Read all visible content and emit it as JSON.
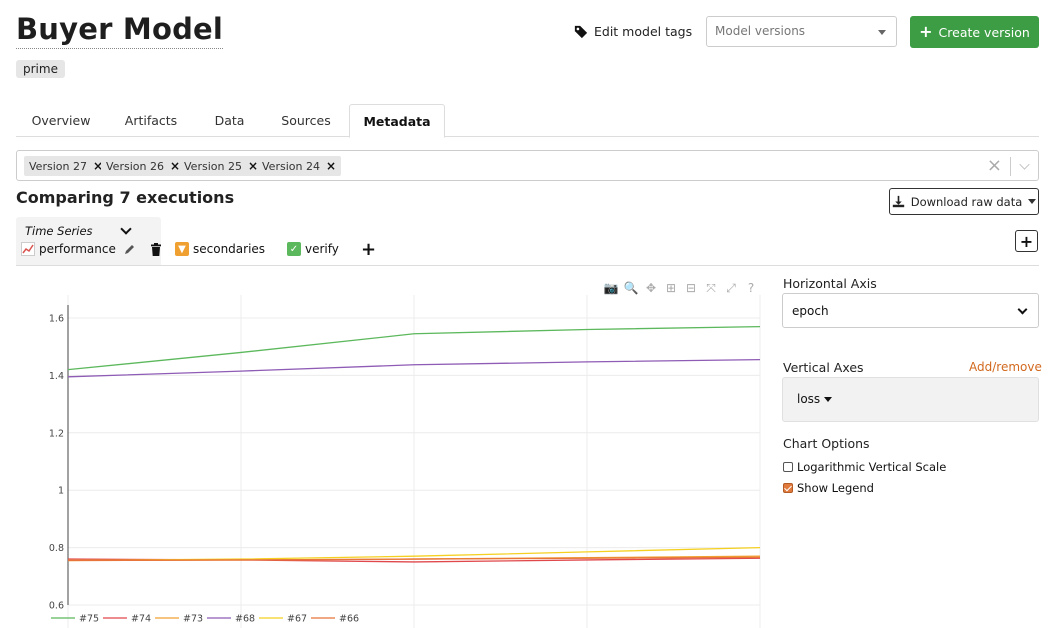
{
  "header": {
    "title": "Buyer Model",
    "tag": "prime",
    "edit_tags_label": "Edit model tags",
    "versions_placeholder": "Model versions",
    "create_label": "Create version"
  },
  "tabs": [
    "Overview",
    "Artifacts",
    "Data",
    "Sources",
    "Metadata"
  ],
  "active_tab": "Metadata",
  "version_filter": [
    "Version 27",
    "Version 26",
    "Version 25",
    "Version 24"
  ],
  "comparing_title": "Comparing 7 executions",
  "download_label": "Download raw data",
  "chart_group": {
    "type_label": "Time Series",
    "tabs": [
      {
        "icon": "chart-icon",
        "label": "performance"
      },
      {
        "icon": "orange-triangle-icon",
        "label": "secondaries"
      },
      {
        "icon": "green-check-icon",
        "label": "verify"
      }
    ]
  },
  "side": {
    "horizontal_axis_label": "Horizontal Axis",
    "horizontal_axis_value": "epoch",
    "vertical_axes_label": "Vertical Axes",
    "add_remove": "Add/remove",
    "vertical_axis_value": "loss",
    "chart_options_label": "Chart Options",
    "options": [
      {
        "label": "Logarithmic Vertical Scale",
        "checked": false
      },
      {
        "label": "Show Legend",
        "checked": true
      }
    ]
  },
  "chart_data": {
    "type": "line",
    "x": [
      0,
      1,
      2,
      3,
      4
    ],
    "ylim": [
      0.6,
      1.65
    ],
    "yticks": [
      "1.6",
      "1.4",
      "1.2",
      "1",
      "0.8",
      "0.6"
    ],
    "ytick_values": [
      1.6,
      1.4,
      1.2,
      1.0,
      0.8,
      0.6
    ],
    "legend": "bottom",
    "grid": true,
    "series": [
      {
        "name": "#75",
        "color": "#5cb85c",
        "values": [
          1.42,
          1.48,
          1.545,
          1.56,
          1.57
        ]
      },
      {
        "name": "#74",
        "color": "#e0484b",
        "values": [
          0.76,
          0.757,
          0.75,
          0.757,
          0.763
        ]
      },
      {
        "name": "#73",
        "color": "#f0a030",
        "values": [
          0.755,
          0.757,
          0.76,
          0.765,
          0.77
        ]
      },
      {
        "name": "#68",
        "color": "#8e5bb5",
        "values": [
          1.395,
          1.415,
          1.437,
          1.447,
          1.455
        ]
      },
      {
        "name": "#67",
        "color": "#f5d020",
        "values": [
          0.755,
          0.76,
          0.77,
          0.785,
          0.8
        ]
      },
      {
        "name": "#66",
        "color": "#e8743b",
        "values": [
          0.755,
          0.757,
          0.76,
          0.763,
          0.766
        ]
      }
    ]
  }
}
